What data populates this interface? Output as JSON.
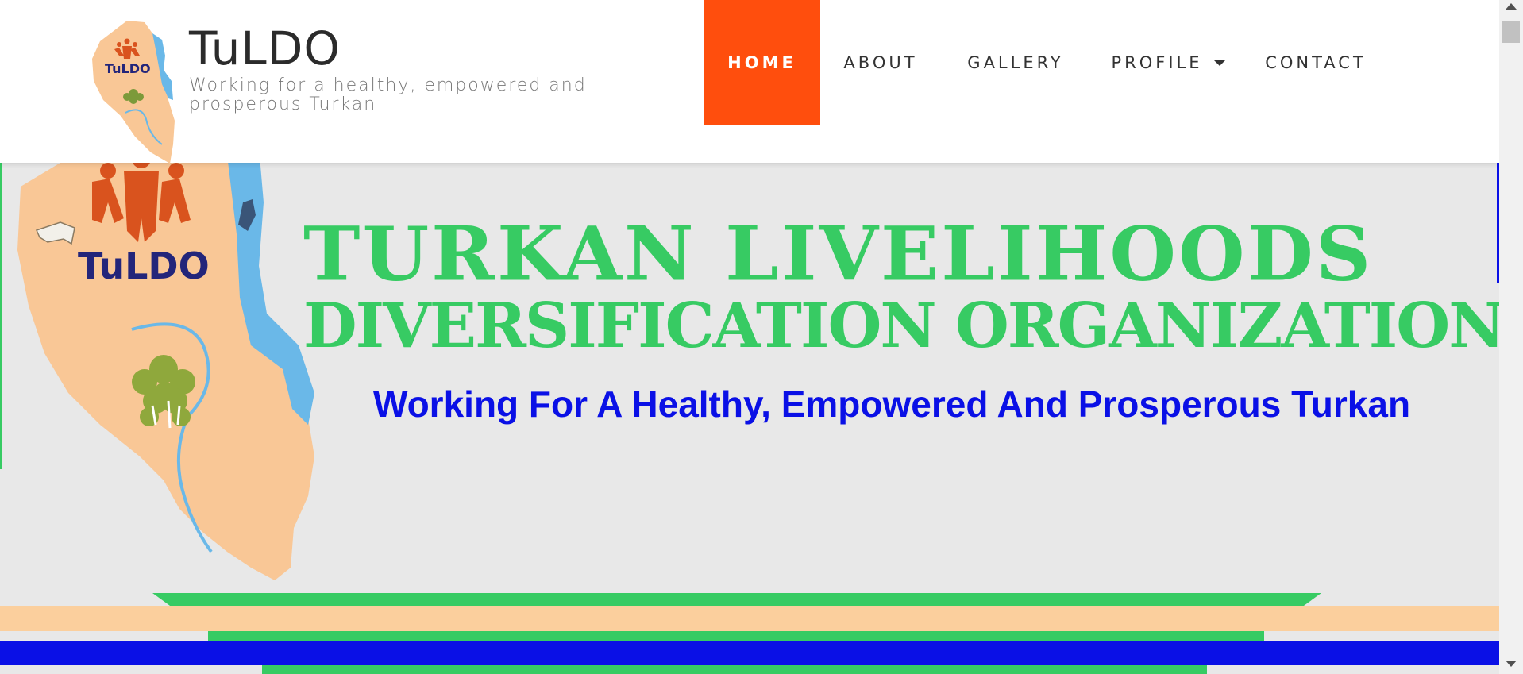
{
  "site": {
    "title": "TuLDO",
    "tagline": "Working for a healthy, empowered and prosperous Turkan",
    "logo_text": "TuLDO"
  },
  "nav": {
    "items": [
      {
        "label": "HOME",
        "active": true
      },
      {
        "label": "ABOUT",
        "active": false
      },
      {
        "label": "GALLERY",
        "active": false
      },
      {
        "label": "PROFILE",
        "active": false,
        "has_dropdown": true
      },
      {
        "label": "CONTACT",
        "active": false
      }
    ]
  },
  "banner": {
    "logo_text": "TuLDO",
    "title_line1": "TURKAN LIVELIHOODS",
    "title_line2": "DIVERSIFICATION ORGANIZATION",
    "subtitle": "Working For A Healthy, Empowered And Prosperous Turkan"
  },
  "colors": {
    "accent": "#ff4e0d",
    "green": "#37cb63",
    "blue": "#0a10e6",
    "peach": "#fbcf9d",
    "map_orange": "#d9531e",
    "lake_blue": "#6ab8e8"
  },
  "icons": {
    "dropdown": "chevron-down-icon",
    "scroll_up": "arrow-up-icon",
    "scroll_down": "arrow-down-icon"
  }
}
